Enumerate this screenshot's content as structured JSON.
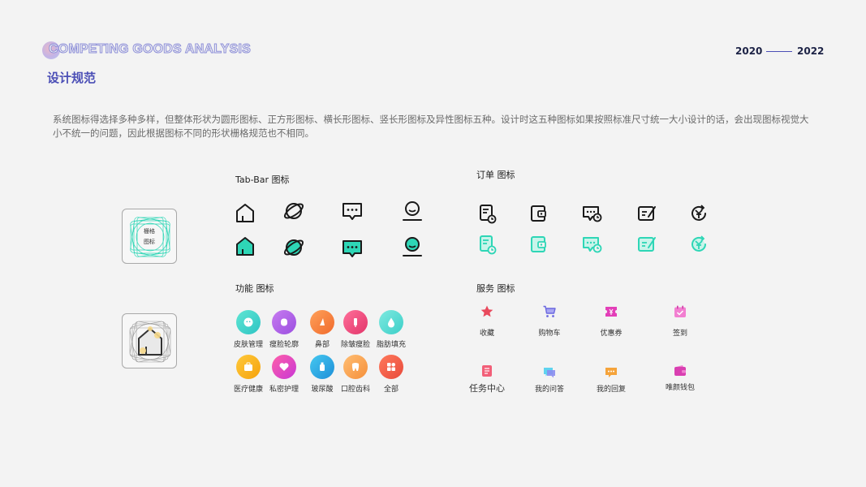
{
  "header": {
    "title": "COMPETING GOODS ANALYSIS",
    "subtitle": "设计规范",
    "year_start": "2020",
    "year_end": "2022"
  },
  "description": "系统图标得选择多种多样，但整体形状为圆形图标、正方形图标、横长形图标、竖长形图标及异性图标五种。设计时这五种图标如果按照标准尺寸统一大小设计的话，会出现图标视觉大小不统一的问题，因此根据图标不同的形状栅格规范也不相同。",
  "grid_card": {
    "label_line1": "栅格",
    "label_line2": "图标"
  },
  "sections": {
    "tabbar": "Tab-Bar 图标",
    "order": "订单 图标",
    "function": "功能  图标",
    "service": "服务 图标"
  },
  "function_items": [
    "皮肤管理",
    "瘦脸轮廓",
    "鼻部",
    "除皱瘦脸",
    "脂肪填充",
    "医疗健康",
    "私密护理",
    "玻尿酸",
    "口腔齿科",
    "全部"
  ],
  "service_items": [
    "收藏",
    "购物车",
    "优惠券",
    "签到",
    "任务中心",
    "我的问答",
    "我的回复",
    "唯颜钱包"
  ],
  "colors": {
    "accent_purple": "#4b4fb6",
    "accent_teal": "#2ed6b6",
    "outline_title": "#8d8fd8"
  }
}
